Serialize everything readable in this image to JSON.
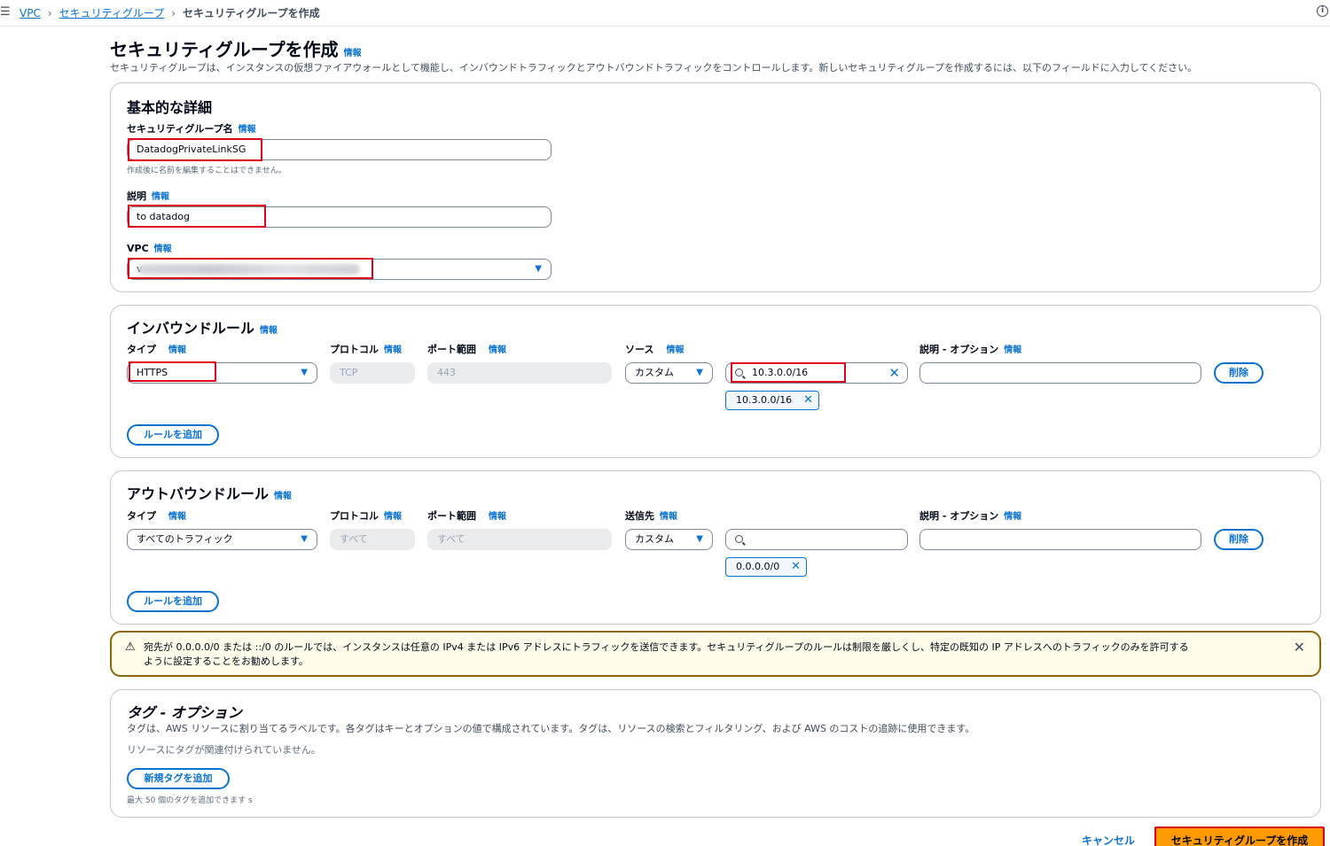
{
  "breadcrumb": {
    "hamburger_icon": "menu-icon",
    "items": [
      "VPC",
      "セキュリティグループ"
    ],
    "current": "セキュリティグループを作成"
  },
  "page": {
    "title": "セキュリティグループを作成",
    "info": "情報",
    "description": "セキュリティグループは、インスタンスの仮想ファイアウォールとして機能し、インバウンドトラフィックとアウトバウンドトラフィックをコントロールします。新しいセキュリティグループを作成するには、以下のフィールドに入力してください。"
  },
  "basic": {
    "title": "基本的な詳細",
    "name_label": "セキュリティグループ名",
    "name_value": "DatadogPrivateLinkSG",
    "name_hint": "作成後に名前を編集することはできません。",
    "desc_label": "説明",
    "desc_value": "to datadog",
    "vpc_label": "VPC",
    "vpc_value": "v"
  },
  "inbound": {
    "title": "インバウンドルール",
    "col_type": "タイプ",
    "col_protocol": "プロトコル",
    "col_port": "ポート範囲",
    "col_source": "ソース",
    "col_desc": "説明 - オプション",
    "type_value": "HTTPS",
    "protocol_value": "TCP",
    "port_value": "443",
    "source_mode": "カスタム",
    "source_search": "10.3.0.0/16",
    "source_token": "10.3.0.0/16",
    "delete_label": "削除",
    "add_rule_label": "ルールを追加"
  },
  "outbound": {
    "title": "アウトバウンドルール",
    "col_type": "タイプ",
    "col_protocol": "プロトコル",
    "col_port": "ポート範囲",
    "col_dest": "送信先",
    "col_desc": "説明 - オプション",
    "type_value": "すべてのトラフィック",
    "protocol_value": "すべて",
    "port_value": "すべて",
    "dest_mode": "カスタム",
    "dest_token": "0.0.0.0/0",
    "delete_label": "削除",
    "add_rule_label": "ルールを追加"
  },
  "alert": {
    "line1": "宛先が 0.0.0.0/0 または ::/0 のルールでは、インスタンスは任意の IPv4 または IPv6 アドレスにトラフィックを送信できます。セキュリティグループのルールは制限を厳しくし、特定の既知の IP アドレスへのトラフィックのみを許可する",
    "line2": "ように設定することをお勧めします。"
  },
  "tags": {
    "title": "タグ - オプション",
    "description": "タグは、AWS リソースに割り当てるラベルです。各タグはキーとオプションの値で構成されています。タグは、リソースの検索とフィルタリング、および AWS のコストの追跡に使用できます。",
    "empty": "リソースにタグが関連付けられていません。",
    "add_label": "新規タグを追加",
    "limit": "最大 50 個のタグを追加できます s"
  },
  "footer": {
    "cancel": "キャンセル",
    "create": "セキュリティグループを作成"
  },
  "colors": {
    "link": "#0972d3",
    "highlight": "#e0001b",
    "primary": "#ff9900"
  }
}
